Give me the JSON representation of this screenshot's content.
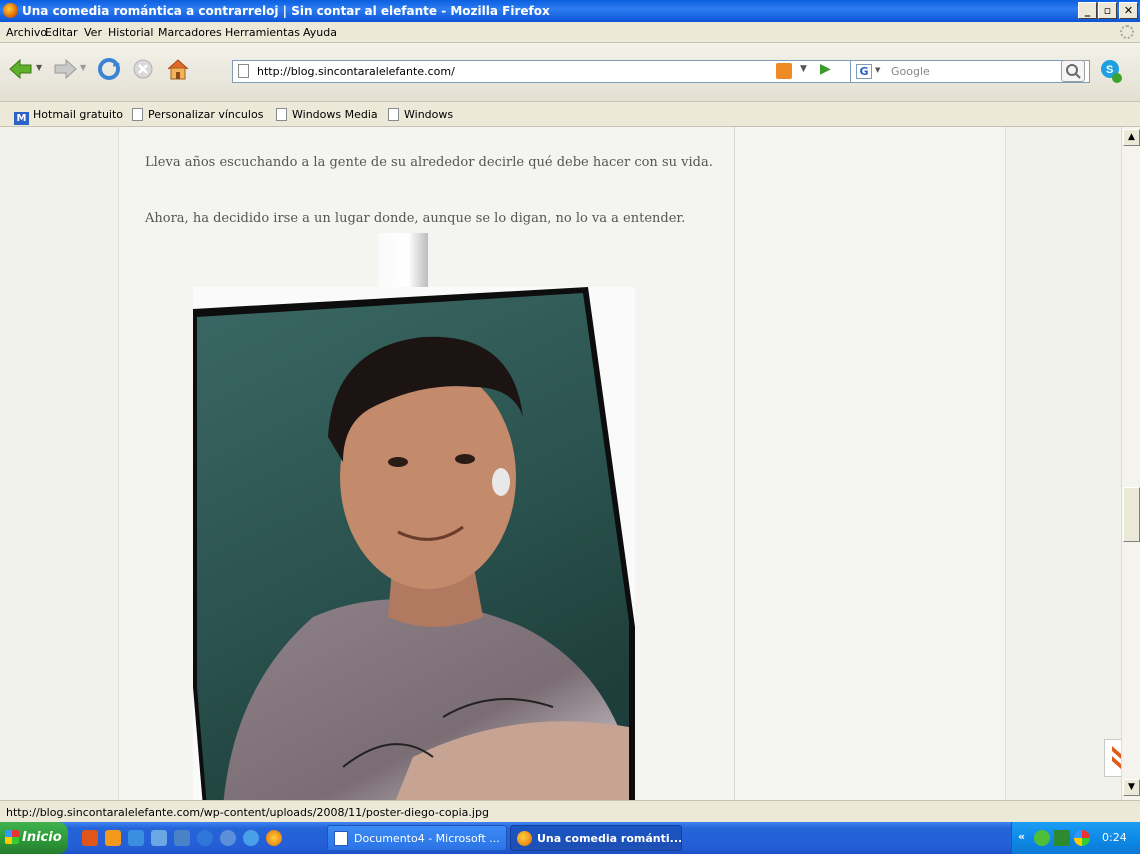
{
  "window": {
    "title": "Una comedia romántica a contrarreloj | Sin contar al elefante - Mozilla Firefox"
  },
  "menu": [
    "Archivo",
    "Editar",
    "Ver",
    "Historial",
    "Marcadores",
    "Herramientas",
    "Ayuda"
  ],
  "nav": {
    "url": "http://blog.sincontaralelefante.com/",
    "search_placeholder": "Google"
  },
  "bookmarks": [
    "Hotmail gratuito",
    "Personalizar vínculos",
    "Windows Media",
    "Windows"
  ],
  "content": {
    "paragraph1": "Lleva años escuchando a la gente de su alrededor decirle qué debe hacer con su vida.",
    "paragraph2": "Ahora, ha decidido irse a un lugar donde, aunque se lo digan, no lo va a entender."
  },
  "status": {
    "text": "http://blog.sincontaralelefante.com/wp-content/uploads/2008/11/poster-diego-copia.jpg"
  },
  "taskbar": {
    "start_label": "Inicio",
    "tasks": [
      "Documento4 - Microsoft ...",
      "Una comedia románti..."
    ],
    "clock": "0:24"
  },
  "colors": {
    "xp_blue": "#0a5fe0",
    "start_green": "#2e9c3a",
    "tray_blue": "#0e8ae8"
  }
}
